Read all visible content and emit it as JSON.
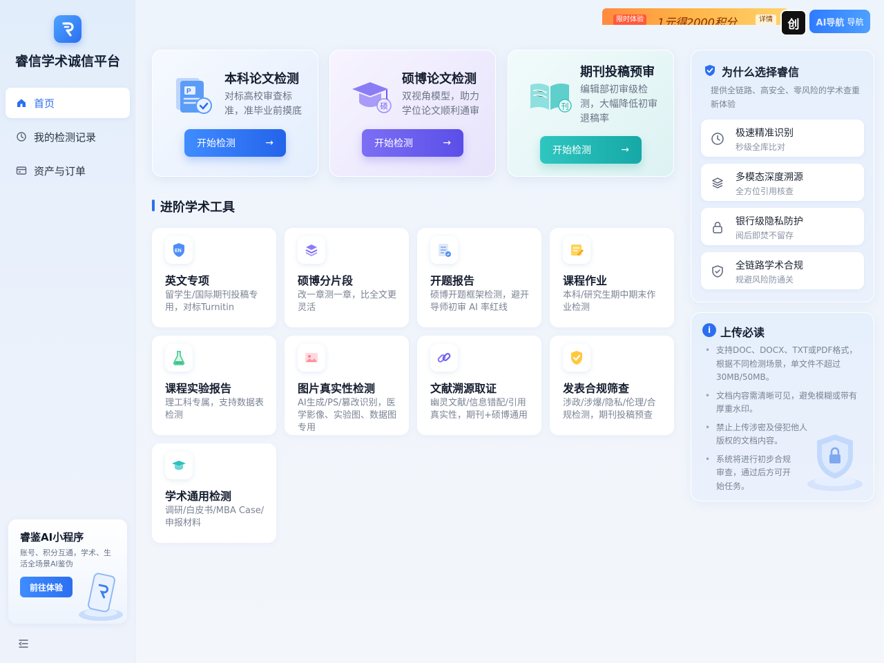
{
  "sidebar": {
    "brand": "睿信学术诚信平台",
    "items": [
      {
        "label": "首页",
        "icon": "home-icon",
        "active": true
      },
      {
        "label": "我的检测记录",
        "icon": "history-icon",
        "active": false
      },
      {
        "label": "资产与订单",
        "icon": "card-icon",
        "active": false
      }
    ],
    "mini": {
      "title": "睿鉴AI小程序",
      "desc": "账号、积分互通，学术、生活全场景AI鉴伪",
      "button": "前往体验"
    }
  },
  "topbar": {
    "promo_tag": "限时体验",
    "promo_text": "1元得2000积分",
    "promo_detail": "详情",
    "douyin_label": "创",
    "nav_label": "AI导航",
    "nav_sub": "导航"
  },
  "hero_cards": [
    {
      "title": "本科论文检测",
      "desc": "对标高校审查标准，准毕业前摸底",
      "button": "开始检测",
      "arrow": "→"
    },
    {
      "title": "硕博论文检测",
      "desc": "双视角模型，助力学位论文顺利通审",
      "button": "开始检测",
      "arrow": "→",
      "badge": "硕"
    },
    {
      "title": "期刊投稿预审",
      "desc": "编辑部初审级检测，大幅降低初审退稿率",
      "button": "开始检测",
      "arrow": "→",
      "badge": "刊"
    }
  ],
  "section_title": "进阶学术工具",
  "tools": [
    {
      "name": "英文专项",
      "desc": "留学生/国际期刊投稿专用，对标Turnitin",
      "icon": "en-shield-icon",
      "badge": "EN"
    },
    {
      "name": "硕博分片段",
      "desc": "改一章测一章，比全文更灵活",
      "icon": "layers-icon"
    },
    {
      "name": "开题报告",
      "desc": "硕博开题框架检测，避开导师初审 AI 率红线",
      "icon": "report-icon"
    },
    {
      "name": "课程作业",
      "desc": "本科/研究生期中期末作业检测",
      "icon": "homework-icon"
    },
    {
      "name": "课程实验报告",
      "desc": "理工科专属，支持数据表检测",
      "icon": "flask-icon"
    },
    {
      "name": "图片真实性检测",
      "desc": "AI生成/PS/篡改识别，医学影像、实验图、数据图专用",
      "icon": "image-icon"
    },
    {
      "name": "文献溯源取证",
      "desc": "幽灵文献/信息错配/引用真实性，期刊+硕博通用",
      "icon": "link-icon"
    },
    {
      "name": "发表合规筛查",
      "desc": "涉政/涉爆/隐私/伦理/合规检测，期刊投稿预查",
      "icon": "check-shield-icon"
    },
    {
      "name": "学术通用检测",
      "desc": "调研/白皮书/MBA Case/申报材料",
      "icon": "graduation-cap-icon"
    }
  ],
  "why": {
    "title": "为什么选择睿信",
    "desc": "提供全链路、高安全、零风险的学术查重新体验",
    "features": [
      {
        "name": "极速精准识别",
        "sub": "秒级全库比对",
        "icon": "clock-icon"
      },
      {
        "name": "多模态深度溯源",
        "sub": "全方位引用核查",
        "icon": "stack-icon"
      },
      {
        "name": "银行级隐私防护",
        "sub": "阅后即焚不留存",
        "icon": "lock-icon"
      },
      {
        "name": "全链路学术合规",
        "sub": "规避风险防通关",
        "icon": "shield-check-icon"
      }
    ]
  },
  "upload": {
    "title": "上传必读",
    "icon_text": "i",
    "items": [
      "支持DOC、DOCX、TXT或PDF格式，根据不同检测场景，单文件不超过30MB/50MB。",
      "文档内容需清晰可见，避免模糊或带有厚重水印。",
      "禁止上传涉密及侵犯他人版权的文档内容。",
      "系统将进行初步合规审查，通过后方可开始任务。"
    ]
  },
  "colors": {
    "accent": "#2b6ff0",
    "teal": "#1fb5b0",
    "purple": "#6a5cf0"
  }
}
